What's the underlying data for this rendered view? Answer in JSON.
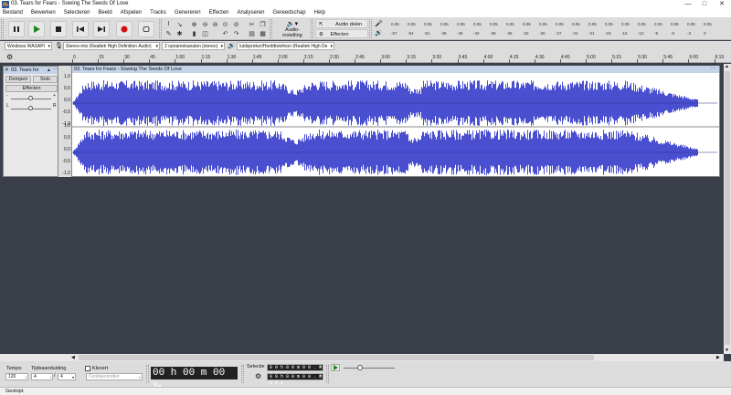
{
  "window": {
    "title": "03. Tears for Fears - Sowing The Seeds Of Love"
  },
  "menu": [
    "Bestand",
    "Bewerken",
    "Selecteren",
    "Beeld",
    "Afspelen",
    "Tracks",
    "Genereren",
    "Effecten",
    "Analyseren",
    "Gereedschap",
    "Help"
  ],
  "toolbar": {
    "audio_setup_label": "Audio-instelling",
    "share_audio_label": "Audio delen",
    "get_effects_label": "Effecten ophalen"
  },
  "meter": {
    "ticks_top": [
      "-57",
      "-54",
      "-51",
      "-48",
      "-45",
      "-42",
      "-3",
      "0",
      "-57",
      "-54",
      "-51",
      "-48",
      "-45",
      "-42",
      "-3",
      "0"
    ],
    "top_values": [
      "0.05",
      "0.05",
      "0.05",
      "0.05",
      "0.05",
      "0.05",
      "0.05",
      "0.05",
      "0.05",
      "0.05",
      "0.05",
      "0.05",
      "0.05",
      "0.05",
      "0.05",
      "0.05",
      "0.05",
      "0.05",
      "0.05",
      "0.05",
      "0.05",
      "0.05",
      "0.05"
    ],
    "bottom_values": [
      "-57",
      "-54",
      "-51",
      "-48",
      "-45",
      "-42",
      "-39",
      "-36",
      "-33",
      "-30",
      "-27",
      "-24",
      "-21",
      "-18",
      "-15",
      "-12",
      "-9",
      "-6",
      "-3",
      "0"
    ]
  },
  "devices": {
    "host": "Windows WASAPI",
    "recording": "Stereo-mix (Realtek High Definition Audio)",
    "channels": "2 opnamekanalen (stereo)",
    "playback": "luidspreker/Hoofdtelefoon (Realtek High De"
  },
  "timeline": {
    "ticks": [
      "0",
      "15",
      "30",
      "45",
      "1:00",
      "1:15",
      "1:30",
      "1:45",
      "2:00",
      "2:15",
      "2:30",
      "2:45",
      "3:00",
      "3:15",
      "3:30",
      "3:45",
      "4:00",
      "4:15",
      "4:30",
      "4:45",
      "5:00",
      "5:15",
      "5:30",
      "5:45",
      "6:00",
      "6:15"
    ]
  },
  "track": {
    "name": "03. Tears for",
    "clip_name": "03. Tears for Fears - Sowing The Seeds Of Love",
    "mute_label": "Dempen",
    "solo_label": "Solo",
    "effects_label": "Effecten",
    "gain_minus": "-",
    "gain_plus": "+",
    "pan_left": "L",
    "pan_right": "R",
    "y_labels": [
      "1,0",
      "0,5",
      "0,0",
      "-0,5",
      "-1,0"
    ],
    "wave_color": "#4a4fd0"
  },
  "bottom": {
    "tempo_label": "Tempo",
    "tempo_value": "120",
    "signature_label": "Tijdsaanduiding",
    "sig_num": "4",
    "sig_den": "4",
    "snap_label": "Klevert",
    "snap_value": "Centiseconden",
    "time_display": "00 h 00 m 00 s",
    "selection_label": "Selectie",
    "sel_start": "0 0 h 0 0 m 0 0 . 0 0 0 s",
    "sel_end": "0 0 h 0 0 m 0 0 . 0 0 0 s"
  },
  "status": {
    "text": "Gestopt."
  }
}
